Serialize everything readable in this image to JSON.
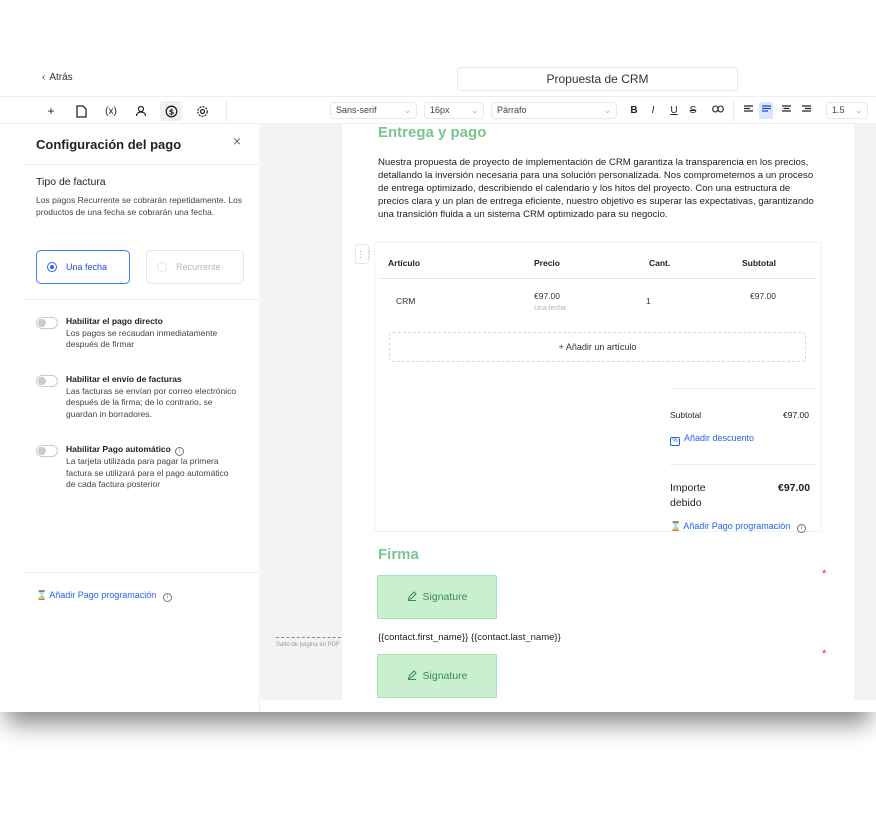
{
  "titlebar": {
    "back_label": "Atrás",
    "doc_title": "Propuesta de CRM"
  },
  "toolbar": {
    "icons": [
      "plus-icon",
      "page-icon",
      "variable-icon",
      "user-icon",
      "payment-icon",
      "gear-icon"
    ],
    "font_family": "Sans-serif",
    "font_size": "16px",
    "block_type": "Párrafo",
    "line_height": "1.5",
    "bold": "B",
    "italic": "I",
    "underline": "U",
    "strike": "S"
  },
  "panel": {
    "title": "Configuración del pago",
    "invoice_type_title": "Tipo de factura",
    "invoice_type_desc": "Los pagos Recurrente se cobrarán repetidamente. Los productos de una fecha se cobrarán una fecha.",
    "option_one_time": "Una fecha",
    "option_recurring": "Recurrente",
    "toggles": [
      {
        "title": "Habilitar el pago directo",
        "desc": "Los pagos se recaudan inmediatamente después de firmar"
      },
      {
        "title": "Habilitar el envío de facturas",
        "desc": "Las facturas se envían por correo electrónico después de la firma; de lo contrario, se guardan in borradores."
      },
      {
        "title": "Habilitar Pago automático",
        "desc": "La tarjeta utilizada para pagar la primera factura se utilizará para el pago automático de cada factura posterior"
      }
    ],
    "add_schedule": "Añadir Pago programación"
  },
  "document": {
    "section_title": "Entrega y pago",
    "paragraph": "Nuestra propuesta de proyecto de implementación de CRM garantiza la transparencia en los precios, detallando la inversión necesaria para una solución personalizada. Nos comprometemos a un proceso de entrega optimizado, describiendo el calendario y los hitos del proyecto. Con una estructura de precios clara y un plan de entrega eficiente, nuestro objetivo es superar las expectativas, garantizando una transición fluida a un sistema CRM optimizado para su negocio.",
    "table": {
      "headers": [
        "Artículo",
        "Precio",
        "Cant.",
        "Subtotal"
      ],
      "rows": [
        {
          "item": "CRM",
          "price": "€97.00",
          "price_note": "Una fecha",
          "qty": "1",
          "subtotal": "€97.00"
        }
      ],
      "add_item": "+ Añadir un artículo"
    },
    "summary": {
      "subtotal_label": "Subtotal",
      "subtotal_value": "€97.00",
      "add_discount": "Añadir descuento",
      "amount_due_label": "Importe debido",
      "amount_due_value": "€97.00",
      "add_schedule": "Añadir Pago programación"
    },
    "signature_title": "Firma",
    "signature_label": "Signature",
    "merge_fields": "{{contact.first_name}} {{contact.last_name}}",
    "required_mark": "*",
    "page_break_label": "Salto de página en PDF"
  }
}
